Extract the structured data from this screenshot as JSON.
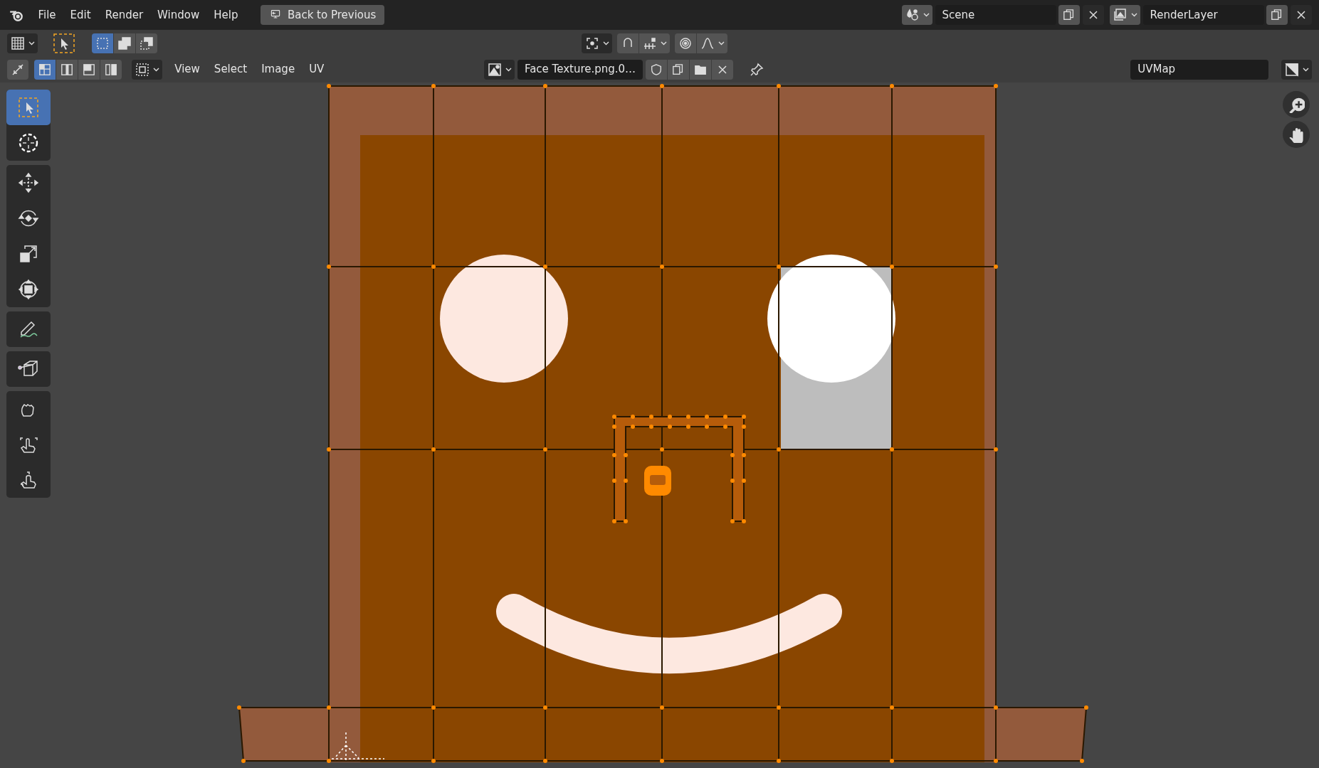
{
  "menu": [
    "File",
    "Edit",
    "Render",
    "Window",
    "Help"
  ],
  "back_button": "Back to Previous",
  "scene": {
    "name": "Scene"
  },
  "render_layer": {
    "name": "RenderLayer"
  },
  "header": {
    "select_modes": [
      {
        "selected": true
      },
      {
        "selected": false
      },
      {
        "selected": false
      }
    ],
    "uv_select_modes": [
      {
        "selected": true
      },
      {
        "selected": false
      },
      {
        "selected": false
      },
      {
        "selected": false
      }
    ],
    "menus": [
      "View",
      "Select",
      "Image",
      "UV"
    ],
    "image_name": "Face Texture.png.0…",
    "uv_map": "UVMap"
  },
  "tool_groups": [
    [
      {
        "kind": "select",
        "selected": true
      },
      {
        "kind": "cursor",
        "selected": false
      }
    ],
    [
      {
        "kind": "move",
        "selected": false
      },
      {
        "kind": "rotate",
        "selected": false
      },
      {
        "kind": "scale",
        "selected": false
      },
      {
        "kind": "transform",
        "selected": false
      }
    ],
    [
      {
        "kind": "annotate",
        "selected": false
      }
    ],
    [
      {
        "kind": "rip",
        "selected": false
      }
    ],
    [
      {
        "kind": "grab",
        "selected": false
      },
      {
        "kind": "relax",
        "selected": false
      },
      {
        "kind": "pinch",
        "selected": false
      }
    ]
  ]
}
